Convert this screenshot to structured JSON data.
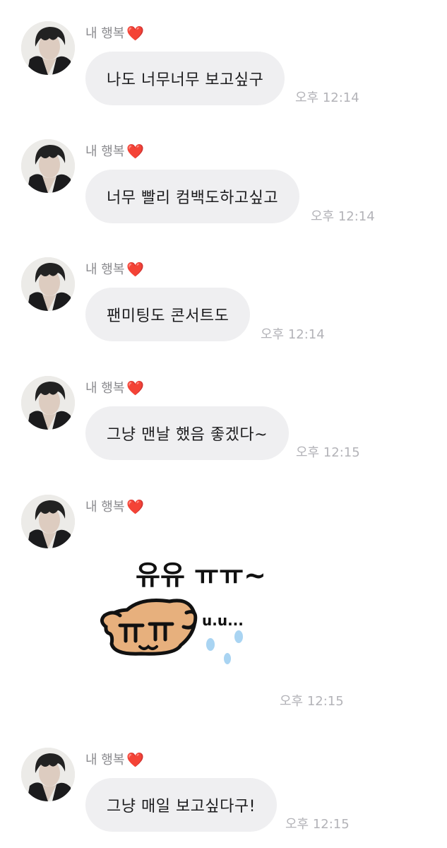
{
  "chat": {
    "sender_name": "내 행복",
    "sender_heart": "❤️",
    "messages": [
      {
        "type": "text",
        "text": "나도 너무너무 보고싶구",
        "time": "오후 12:14"
      },
      {
        "type": "text",
        "text": "너무 빨리 컴백도하고싶고",
        "time": "오후 12:14"
      },
      {
        "type": "text",
        "text": "팬미팅도 콘서트도",
        "time": "오후 12:14"
      },
      {
        "type": "text",
        "text": "그냥 맨날 했음 좋겠다~",
        "time": "오후 12:15"
      },
      {
        "type": "sticker",
        "sticker_text_top": "유유 ㅠㅠ~",
        "sticker_text_side": "u.u...",
        "time": "오후 12:15"
      },
      {
        "type": "text",
        "text": "그냥 매일 보고싶다구!",
        "time": "오후 12:15"
      }
    ]
  },
  "colors": {
    "bubble": "#efeff1",
    "sender_text": "#8a8a8e",
    "time_text": "#b3b3b8",
    "heart": "#e0313a",
    "sticker_dog": "#e7b07d",
    "sticker_tears": "#a9d4f2"
  },
  "icons": {
    "heart": "red-heart-emoji",
    "avatar": "profile-photo"
  }
}
